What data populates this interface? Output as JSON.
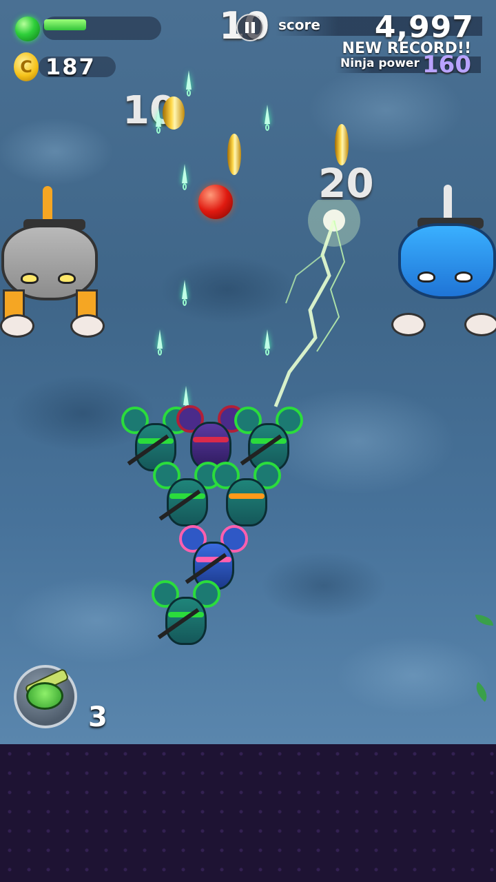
{
  "hud": {
    "coins": "187",
    "coin_symbol": "C",
    "combo": "10",
    "score_label": "score",
    "score_value": "4,997",
    "new_record": "NEW RECORD!!",
    "ninja_power_label": "Ninja power",
    "ninja_power_value": "160",
    "power_gauge_level": 0.36
  },
  "floating_points": [
    "10",
    "20"
  ],
  "item": {
    "count": "3"
  },
  "colors": {
    "ninja_power": "#b9a3ff",
    "life_orb": "#2ecf3a",
    "bottom_band": "#1e1333"
  }
}
